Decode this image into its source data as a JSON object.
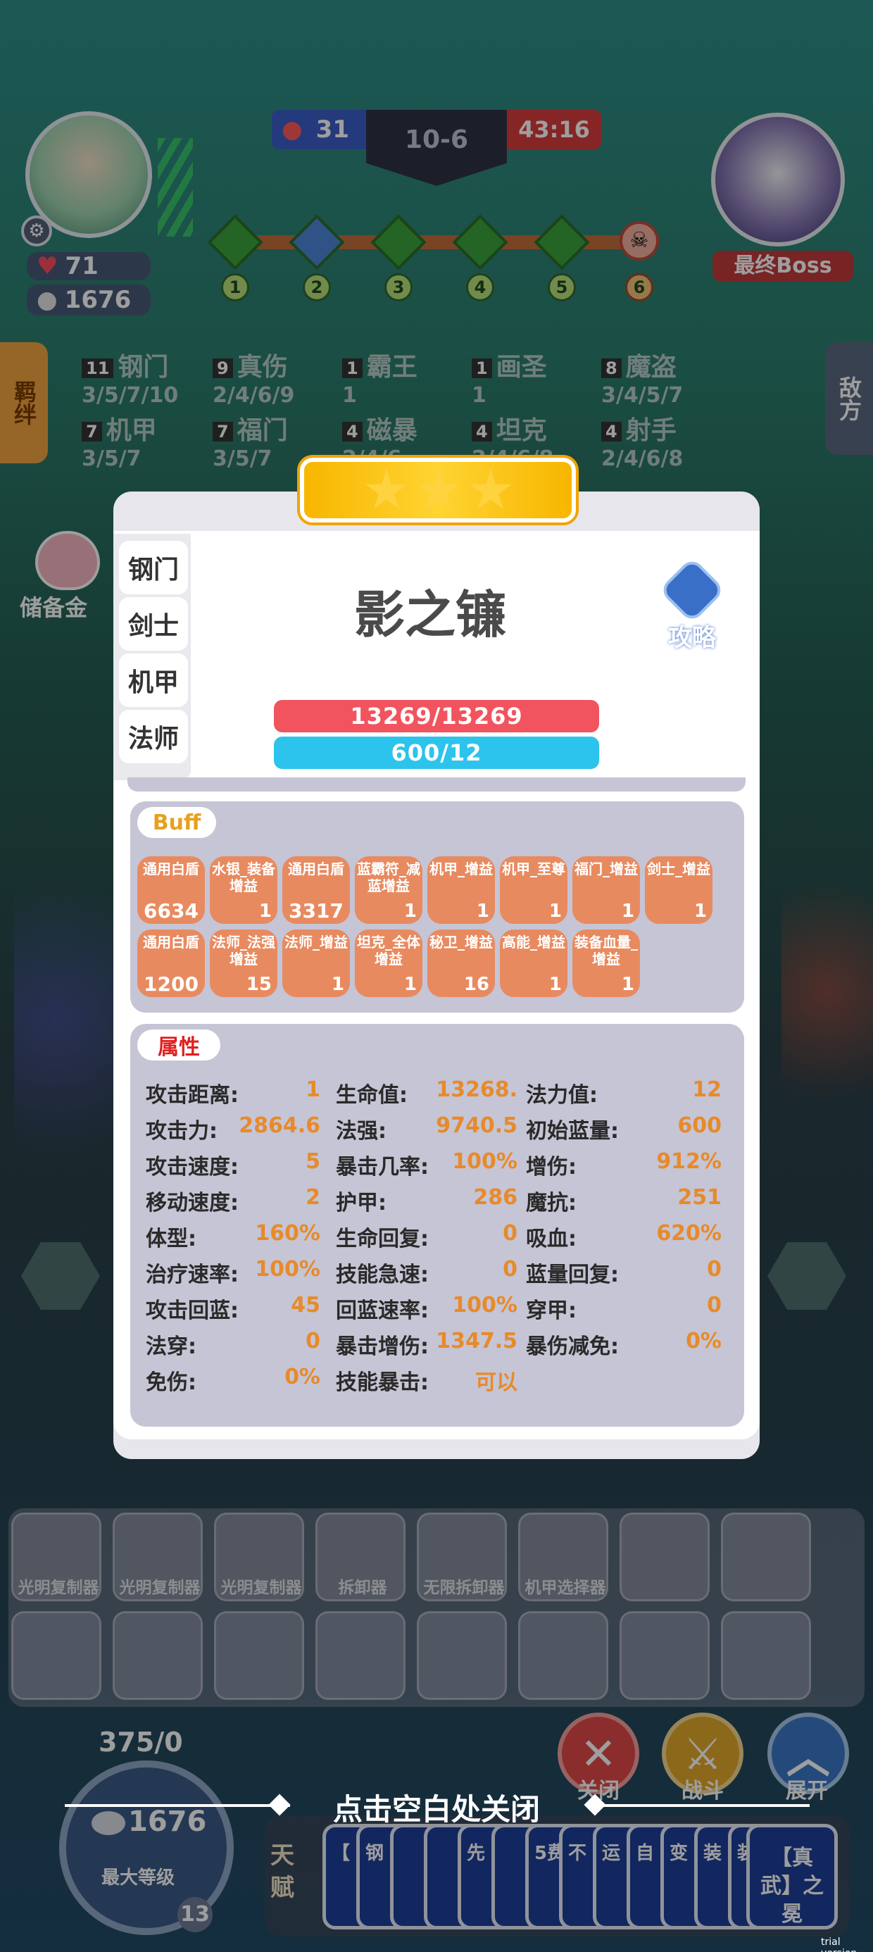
{
  "hud": {
    "player": {
      "hp": "71",
      "gold": "1676"
    },
    "blue_score": "31",
    "round": "10-6",
    "timer": "43:16",
    "stages": [
      "1",
      "2",
      "3",
      "4",
      "5",
      "6"
    ],
    "boss_label": "最终Boss",
    "synergy_tab": "羁绊",
    "enemy_tab": "敌方",
    "savings_label": "储备金"
  },
  "synergies": [
    {
      "count": "11",
      "name": "钢门",
      "tiers": "3/5/7/10"
    },
    {
      "count": "9",
      "name": "真伤",
      "tiers": "2/4/6/9"
    },
    {
      "count": "1",
      "name": "霸王",
      "tiers": "1"
    },
    {
      "count": "1",
      "name": "画圣",
      "tiers": "1"
    },
    {
      "count": "8",
      "name": "魔盗",
      "tiers": "3/4/5/7"
    },
    {
      "count": "7",
      "name": "机甲",
      "tiers": "3/5/7"
    },
    {
      "count": "7",
      "name": "福门",
      "tiers": "3/5/7"
    },
    {
      "count": "4",
      "name": "磁暴",
      "tiers": "2/4/6"
    },
    {
      "count": "4",
      "name": "坦克",
      "tiers": "2/4/6/8"
    },
    {
      "count": "4",
      "name": "射手",
      "tiers": "2/4/6/8"
    }
  ],
  "modal": {
    "unit_name": "影之镰",
    "guide_label": "攻略",
    "star_count": 3,
    "hp_text": "13269/13269",
    "mana_text": "600/12",
    "hp_fill": 1.0,
    "mana_fill": 1.0,
    "tabs": [
      "钢门",
      "剑士",
      "机甲",
      "法师"
    ],
    "buff_title": "Buff",
    "buffs": [
      {
        "name": "通用白盾",
        "value": "6634"
      },
      {
        "name": "水银_装备增益",
        "value": "1"
      },
      {
        "name": "通用白盾",
        "value": "3317"
      },
      {
        "name": "蓝霸符_减蓝增益",
        "value": "1"
      },
      {
        "name": "机甲_增益",
        "value": "1"
      },
      {
        "name": "机甲_至尊",
        "value": "1"
      },
      {
        "name": "福门_增益",
        "value": "1"
      },
      {
        "name": "剑士_增益",
        "value": "1"
      },
      {
        "name": "通用白盾",
        "value": "1200"
      },
      {
        "name": "法师_法强增益",
        "value": "15"
      },
      {
        "name": "法师_增益",
        "value": "1"
      },
      {
        "name": "坦克_全体增益",
        "value": "1"
      },
      {
        "name": "秘卫_增益",
        "value": "16"
      },
      {
        "name": "高能_增益",
        "value": "1"
      },
      {
        "name": "装备血量_增益",
        "value": "1"
      }
    ],
    "attr_title": "属性",
    "attributes": [
      [
        {
          "k": "攻击距离:",
          "v": "1"
        },
        {
          "k": "生命值:",
          "v": "13268."
        },
        {
          "k": "法力值:",
          "v": "12"
        }
      ],
      [
        {
          "k": "攻击力:",
          "v": "2864.6"
        },
        {
          "k": "法强:",
          "v": "9740.5"
        },
        {
          "k": "初始蓝量:",
          "v": "600"
        }
      ],
      [
        {
          "k": "攻击速度:",
          "v": "5"
        },
        {
          "k": "暴击几率:",
          "v": "100%"
        },
        {
          "k": "增伤:",
          "v": "912%"
        }
      ],
      [
        {
          "k": "移动速度:",
          "v": "2"
        },
        {
          "k": "护甲:",
          "v": "286"
        },
        {
          "k": "魔抗:",
          "v": "251"
        }
      ],
      [
        {
          "k": "体型:",
          "v": "160%"
        },
        {
          "k": "生命回复:",
          "v": "0"
        },
        {
          "k": "吸血:",
          "v": "620%"
        }
      ],
      [
        {
          "k": "治疗速率:",
          "v": "100%"
        },
        {
          "k": "技能急速:",
          "v": "0"
        },
        {
          "k": "蓝量回复:",
          "v": "0"
        }
      ],
      [
        {
          "k": "攻击回蓝:",
          "v": "45"
        },
        {
          "k": "回蓝速率:",
          "v": "100%"
        },
        {
          "k": "穿甲:",
          "v": "0"
        }
      ],
      [
        {
          "k": "法穿:",
          "v": "0"
        },
        {
          "k": "暴击增伤:",
          "v": "1347.5"
        },
        {
          "k": "暴伤减免:",
          "v": "0%"
        }
      ],
      [
        {
          "k": "免伤:",
          "v": "0%"
        },
        {
          "k": "技能暴击:",
          "v": "可以"
        },
        {
          "k": "",
          "v": ""
        }
      ]
    ]
  },
  "bench": {
    "items": [
      "光明复制器",
      "光明复制器",
      "光明复制器",
      "拆卸器",
      "无限拆卸器",
      "机甲选择器",
      "",
      ""
    ]
  },
  "bottom": {
    "exp_text": "375/0",
    "gold": "1676",
    "level_label": "最大等级",
    "level": "13",
    "close_hint": "点击空白处关闭",
    "btn_close": "关闭",
    "btn_battle": "战斗",
    "btn_expand": "展开",
    "talent_label": "天赋",
    "last_card": "【真武】之冕",
    "card_glyphs": [
      "【",
      "钢",
      "",
      "",
      "先",
      "",
      "5费",
      "不",
      "运",
      "自",
      "变",
      "装",
      "装"
    ],
    "trial": "trial version"
  }
}
